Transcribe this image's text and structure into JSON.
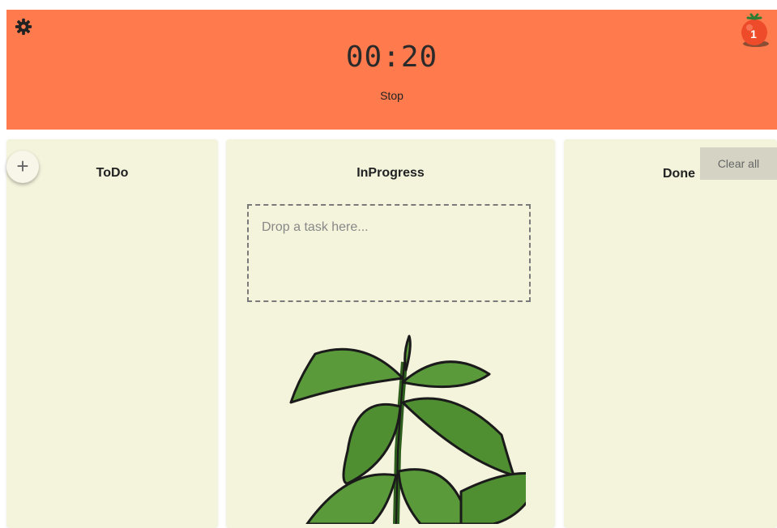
{
  "header": {
    "timer": "00:20",
    "stop_label": "Stop",
    "tomato_count": "1",
    "background_color": "#ff7b4d"
  },
  "icons": {
    "settings": "gear-icon",
    "tomato": "tomato-icon",
    "add": "plus-icon",
    "plant": "plant-illustration"
  },
  "columns": {
    "todo": {
      "title": "ToDo",
      "add_label": "+"
    },
    "inprogress": {
      "title": "InProgress",
      "drop_placeholder": "Drop a task here..."
    },
    "done": {
      "title": "Done",
      "clear_label": "Clear all"
    }
  },
  "colors": {
    "column_bg": "#f4f3dc",
    "clear_button_bg": "#d5d3c3"
  }
}
